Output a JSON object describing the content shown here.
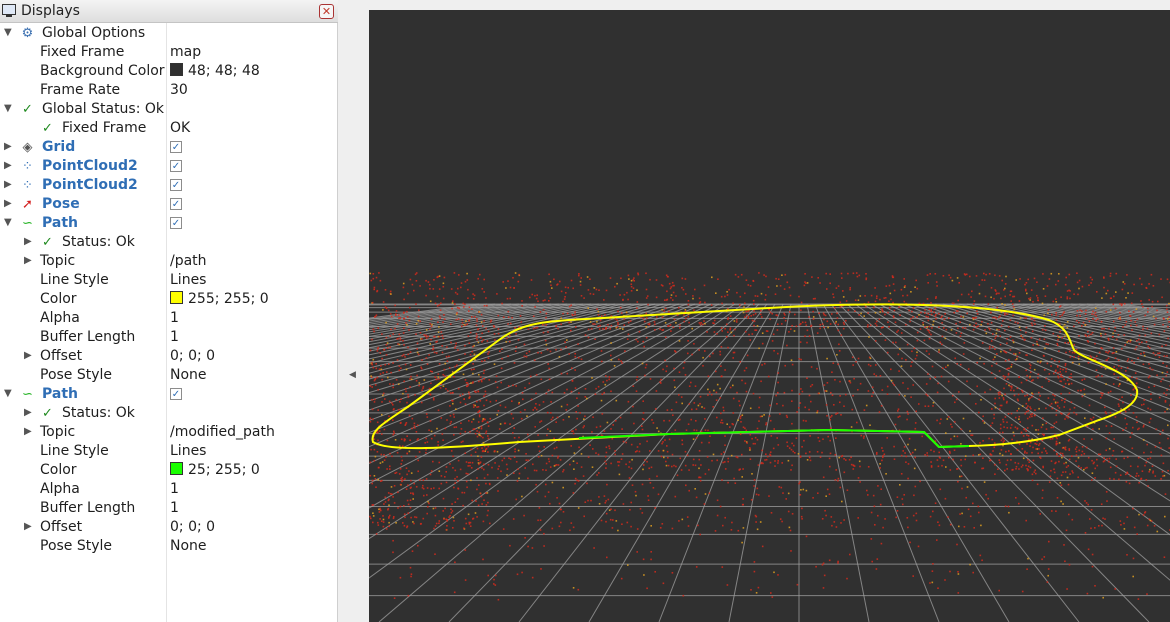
{
  "panel": {
    "title": "Displays",
    "rows": [
      {
        "id": "global-options",
        "label": "Global Options",
        "indent": 0,
        "arrow": "down",
        "icon": "gear-icon",
        "blue": false
      },
      {
        "id": "fixed-frame",
        "label": "Fixed Frame",
        "indent": 1,
        "value": "map"
      },
      {
        "id": "background-color",
        "label": "Background Color",
        "indent": 1,
        "value": "48; 48; 48",
        "swatch": "#303030"
      },
      {
        "id": "frame-rate",
        "label": "Frame Rate",
        "indent": 1,
        "value": "30"
      },
      {
        "id": "global-status",
        "label": "Global Status: Ok",
        "indent": 0,
        "arrow": "down",
        "icon": "check-icon"
      },
      {
        "id": "status-fixed-frame",
        "label": "Fixed Frame",
        "indent": 1,
        "icon": "check-icon",
        "value": "OK"
      },
      {
        "id": "grid",
        "label": "Grid",
        "indent": 0,
        "arrow": "right",
        "icon": "grid-icon",
        "blue": true,
        "checkbox": true
      },
      {
        "id": "pointcloud2-1",
        "label": "PointCloud2",
        "indent": 0,
        "arrow": "right",
        "icon": "pointcloud-icon",
        "blue": true,
        "checkbox": true
      },
      {
        "id": "pointcloud2-2",
        "label": "PointCloud2",
        "indent": 0,
        "arrow": "right",
        "icon": "pointcloud-icon",
        "blue": true,
        "checkbox": true
      },
      {
        "id": "pose",
        "label": "Pose",
        "indent": 0,
        "arrow": "right",
        "icon": "pose-arrow-icon",
        "blue": true,
        "checkbox": true
      },
      {
        "id": "path-1",
        "label": "Path",
        "indent": 0,
        "arrow": "down",
        "icon": "path-icon",
        "blue": true,
        "checkbox": true
      },
      {
        "id": "path-1-status",
        "label": "Status: Ok",
        "indent": 1,
        "arrow": "right",
        "icon": "check-icon"
      },
      {
        "id": "path-1-topic",
        "label": "Topic",
        "indent": 1,
        "arrow": "right",
        "value": "/path"
      },
      {
        "id": "path-1-line-style",
        "label": "Line Style",
        "indent": 1,
        "value": "Lines"
      },
      {
        "id": "path-1-color",
        "label": "Color",
        "indent": 1,
        "value": "255; 255; 0",
        "swatch": "#ffff00"
      },
      {
        "id": "path-1-alpha",
        "label": "Alpha",
        "indent": 1,
        "value": "1"
      },
      {
        "id": "path-1-buffer-length",
        "label": "Buffer Length",
        "indent": 1,
        "value": "1"
      },
      {
        "id": "path-1-offset",
        "label": "Offset",
        "indent": 1,
        "arrow": "right",
        "value": "0; 0; 0"
      },
      {
        "id": "path-1-pose-style",
        "label": "Pose Style",
        "indent": 1,
        "value": "None"
      },
      {
        "id": "path-2",
        "label": "Path",
        "indent": 0,
        "arrow": "down",
        "icon": "path-icon",
        "blue": true,
        "checkbox": true
      },
      {
        "id": "path-2-status",
        "label": "Status: Ok",
        "indent": 1,
        "arrow": "right",
        "icon": "check-icon"
      },
      {
        "id": "path-2-topic",
        "label": "Topic",
        "indent": 1,
        "arrow": "right",
        "value": "/modified_path"
      },
      {
        "id": "path-2-line-style",
        "label": "Line Style",
        "indent": 1,
        "value": "Lines"
      },
      {
        "id": "path-2-color",
        "label": "Color",
        "indent": 1,
        "value": "25; 255; 0",
        "swatch": "#19ff00"
      },
      {
        "id": "path-2-alpha",
        "label": "Alpha",
        "indent": 1,
        "value": "1"
      },
      {
        "id": "path-2-buffer-length",
        "label": "Buffer Length",
        "indent": 1,
        "value": "1"
      },
      {
        "id": "path-2-offset",
        "label": "Offset",
        "indent": 1,
        "arrow": "right",
        "value": "0; 0; 0"
      },
      {
        "id": "path-2-pose-style",
        "label": "Pose Style",
        "indent": 1,
        "value": "None"
      }
    ]
  },
  "viewport": {
    "background": "#303030",
    "grid_color": "#a0a0a0",
    "pointcloud_color": "#d42a1c",
    "path_color": "#ffff00",
    "modified_path_color": "#19ff00"
  }
}
